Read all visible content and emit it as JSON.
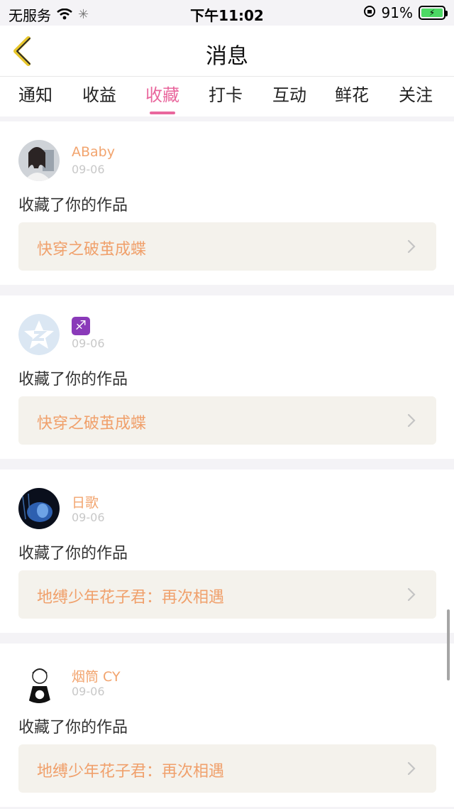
{
  "status": {
    "carrier": "无服务",
    "time": "下午11:02",
    "battery": "91%"
  },
  "nav": {
    "title": "消息"
  },
  "tabs": [
    {
      "label": "通知",
      "active": false
    },
    {
      "label": "收益",
      "active": false
    },
    {
      "label": "收藏",
      "active": true
    },
    {
      "label": "打卡",
      "active": false
    },
    {
      "label": "互动",
      "active": false
    },
    {
      "label": "鲜花",
      "active": false
    },
    {
      "label": "关注",
      "active": false
    }
  ],
  "cards": [
    {
      "user": "ABaby",
      "date": "09-06",
      "action": "收藏了你的作品",
      "work": "快穿之破茧成蝶",
      "avatar": "avatar-photo-girl"
    },
    {
      "user": "♐",
      "date": "09-06",
      "action": "收藏了你的作品",
      "work": "快穿之破茧成蝶",
      "avatar": "avatar-default-star"
    },
    {
      "user": "日歌",
      "date": "09-06",
      "action": "收藏了你的作品",
      "work": "地缚少年花子君：再次相遇",
      "avatar": "avatar-dark-blue"
    },
    {
      "user": "烟筒 CY",
      "date": "09-06",
      "action": "收藏了你的作品",
      "work": "地缚少年花子君：再次相遇",
      "avatar": "avatar-anime-sketch"
    }
  ],
  "colors": {
    "accent": "#e9679d",
    "username": "#f2a46e",
    "work_title": "#f0a06b",
    "work_bg": "#f4f2ec"
  }
}
